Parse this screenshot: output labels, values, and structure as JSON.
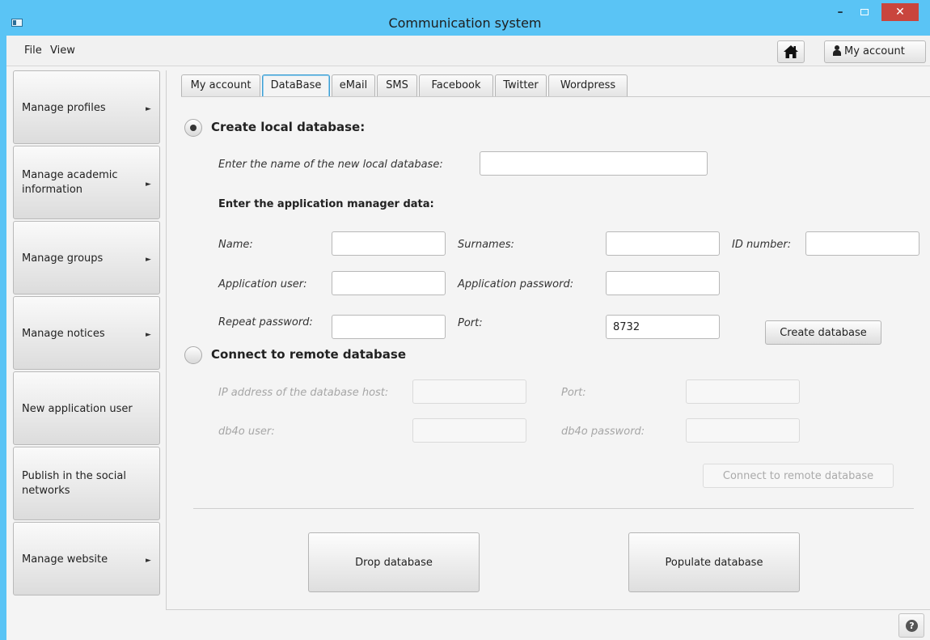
{
  "window": {
    "title": "Communication system",
    "minimize": "–",
    "close": "✕"
  },
  "menubar": {
    "file": "File",
    "view": "View"
  },
  "toolbar": {
    "account_label": "My account"
  },
  "sidebar": {
    "items": [
      {
        "label": "Manage profiles",
        "has_arrow": true
      },
      {
        "label": "Manage academic information",
        "has_arrow": true
      },
      {
        "label": "Manage groups",
        "has_arrow": true
      },
      {
        "label": "Manage notices",
        "has_arrow": true
      },
      {
        "label": "New application user",
        "has_arrow": false
      },
      {
        "label": "Publish in the social networks",
        "has_arrow": false
      },
      {
        "label": "Manage website",
        "has_arrow": true
      }
    ],
    "arrow_glyph": "►"
  },
  "tabs": [
    "My account",
    "DataBase",
    "eMail",
    "SMS",
    "Facebook",
    "Twitter",
    "Wordpress"
  ],
  "active_tab": "DataBase",
  "local": {
    "heading": "Create local database:",
    "selected": true,
    "name_label": "Enter the name of the new local database:",
    "name_value": "",
    "manager_heading": "Enter the application manager data:",
    "name": "Name:",
    "surnames": "Surnames:",
    "id_number": "ID number:",
    "app_user": "Application user:",
    "app_password": "Application password:",
    "repeat_password": "Repeat password:",
    "port": "Port:",
    "port_value": "8732",
    "create_button": "Create database"
  },
  "remote": {
    "heading": "Connect to remote database",
    "selected": false,
    "ip_label": "IP address of the database host:",
    "port_label": "Port:",
    "user_label": "db4o user:",
    "password_label": "db4o password:",
    "connect_button": "Connect to remote database"
  },
  "actions": {
    "drop": "Drop database",
    "populate": "Populate database"
  },
  "help_glyph": "?",
  "colors": {
    "titlebar": "#5ac4f5",
    "close": "#c9453d",
    "tab_active_border": "#3d9fd3"
  }
}
